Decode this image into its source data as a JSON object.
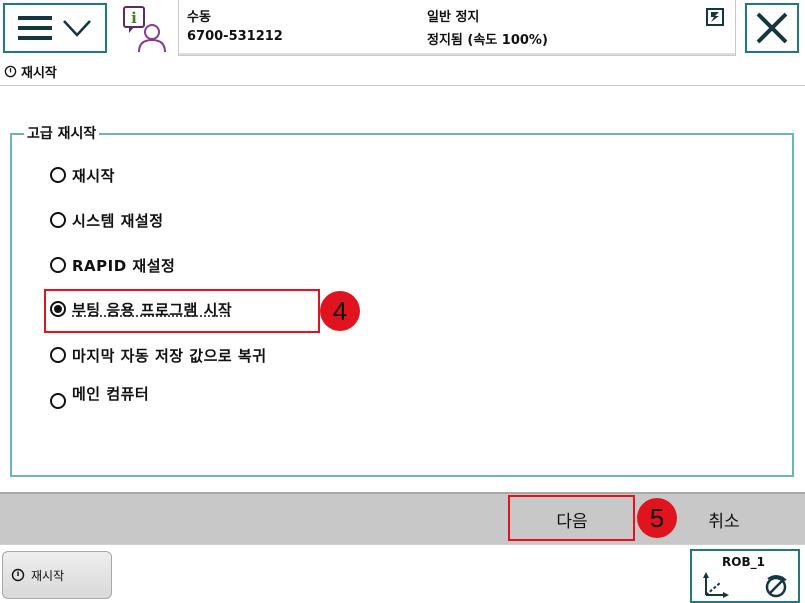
{
  "status": {
    "mode": "수동",
    "controller_id": "6700-531212",
    "state": "일반 정지",
    "speed_status": "정지됨 (속도 100%)"
  },
  "title": {
    "text": "재시작",
    "icon": "power-icon"
  },
  "group": {
    "title": "고급 재시작",
    "options": [
      {
        "label": "재시작",
        "checked": false
      },
      {
        "label": "시스템 재설정",
        "checked": false
      },
      {
        "label": "RAPID 재설정",
        "checked": false
      },
      {
        "label": "부팅 응용 프로그램 시작",
        "checked": true
      },
      {
        "label": "마지막 자동 저장 값으로 복귀",
        "checked": false
      },
      {
        "label": "메인 컴퓨터",
        "checked": false
      }
    ]
  },
  "callouts": {
    "step4": "4",
    "step5": "5"
  },
  "actions": {
    "next": "다음",
    "cancel": "취소"
  },
  "taskbar": {
    "restart_task": "재시작",
    "robot": "ROB_1"
  },
  "colors": {
    "accent": "#1f7a7a",
    "group_border": "#6fb4b4",
    "callout": "#e0141e",
    "action_bar": "#c8c8c8"
  }
}
